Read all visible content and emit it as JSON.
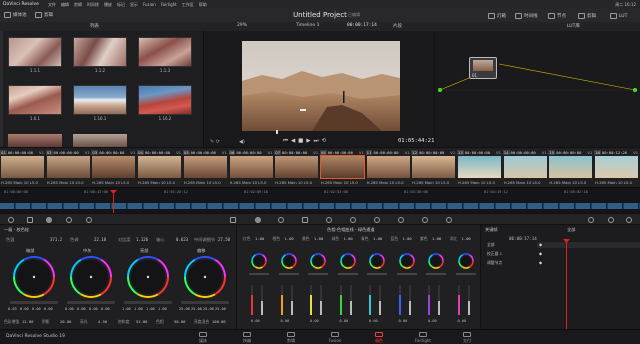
{
  "menubar": {
    "app_name": "DaVinci Resolve",
    "items": [
      "文件",
      "编辑",
      "剪辑",
      "时间线",
      "播放",
      "标记",
      "显示",
      "Fusion",
      "Fairlight",
      "工作区",
      "帮助"
    ],
    "clock": "周二 16:12"
  },
  "toolbar": {
    "media_pool": "媒体池",
    "clips": "剪辑",
    "project_title": "Untitled Project",
    "project_tag": "已编辑",
    "lightbox": "灯箱",
    "gallery": "画廊",
    "timeline_label": "时间线",
    "clips_right": "剪辑",
    "nodes": "节点",
    "lut": "LUT"
  },
  "subbar": {
    "bin": "LUT库",
    "sort": "列表",
    "zoom": "29%",
    "timeline_name": "Timeline 1",
    "timecode": "00:00:17:14",
    "mode": "片段"
  },
  "media": {
    "thumbs": [
      {
        "label": "1.1.1"
      },
      {
        "label": "1.1.2"
      },
      {
        "label": "1.1.3"
      },
      {
        "label": "1.6.1"
      },
      {
        "label": "1.16.1"
      },
      {
        "label": "1.16.2"
      }
    ]
  },
  "viewer": {
    "timecode": "01:05:44:21"
  },
  "node": {
    "label": "01"
  },
  "clips": [
    {
      "num": "01",
      "tc": "00:00:00:00",
      "v": "V1",
      "name": "H.265 Main 10 L5.0"
    },
    {
      "num": "02",
      "tc": "00:00:00:00",
      "v": "V1",
      "name": "H.265 Main 10 L5.0"
    },
    {
      "num": "03",
      "tc": "00:00:00:00",
      "v": "V1",
      "name": "H.265 Main 10 L5.0"
    },
    {
      "num": "04",
      "tc": "00:00:00:00",
      "v": "V1",
      "name": "H.265 Main 10 L5.0"
    },
    {
      "num": "05",
      "tc": "00:00:00:00",
      "v": "V1",
      "name": "H.265 Main 10 L5.0"
    },
    {
      "num": "06",
      "tc": "00:00:00:00",
      "v": "V1",
      "name": "H.265 Main 10 L5.0"
    },
    {
      "num": "07",
      "tc": "00:00:00:00",
      "v": "V1",
      "name": "H.265 Main 10 L5.0"
    },
    {
      "num": "08",
      "tc": "00:00:00:00",
      "v": "V1",
      "name": "H.265 Main 10 L5.0"
    },
    {
      "num": "11",
      "tc": "00:00:00:00",
      "v": "V1",
      "name": "H.265 Main 10 L5.0"
    },
    {
      "num": "12",
      "tc": "00:00:00:00",
      "v": "V1",
      "name": "H.265 Main 10 L5.0"
    },
    {
      "num": "13",
      "tc": "00:00:00:00",
      "v": "V1",
      "name": "H.265 Main 10 L5.0"
    },
    {
      "num": "14",
      "tc": "00:00:00:00",
      "v": "V1",
      "name": "H.265 Main 10 L5.0"
    },
    {
      "num": "15",
      "tc": "00:00:00:00",
      "v": "V1",
      "name": "H.265 Main 10 L5.0"
    },
    {
      "num": "16",
      "tc": "00:00:12:26",
      "v": "V1",
      "name": "H.265 Main 10 L5.0"
    }
  ],
  "minitl": {
    "ticks": [
      "01:00:00:00",
      "01:00:43:06",
      "01:01:26:12",
      "01:02:09:18",
      "01:02:53:00",
      "01:03:36:06",
      "01:04:19:12",
      "01:05:02:18"
    ]
  },
  "wheels": {
    "panel_title": "一级 - 校色轮",
    "temp_label": "色温",
    "temp_val": "371.2",
    "tint_label": "色调",
    "tint_val": "22.18",
    "contrast_label": "对比度",
    "contrast_val": "1.126",
    "pivot_label": "轴心",
    "pivot_val": "0.623",
    "md_label": "中间调细节",
    "md_val": "27.50",
    "names": [
      "暗部",
      "中灰",
      "亮部",
      "偏移"
    ],
    "vals": [
      [
        "0.03",
        "0.00",
        "0.00",
        "0.00"
      ],
      [
        "0.00",
        "0.00",
        "0.00",
        "0.00"
      ],
      [
        "1.00",
        "1.00",
        "1.00",
        "1.00"
      ],
      [
        "25.00",
        "25.00",
        "25.00",
        "25.00"
      ]
    ],
    "bottom": [
      {
        "label": "色彩增强",
        "val": "12.00"
      },
      {
        "label": "阴影",
        "val": "20.00"
      },
      {
        "label": "高光",
        "val": "4.50"
      },
      {
        "label": "饱和度",
        "val": "51.80"
      },
      {
        "label": "色相",
        "val": "50.00"
      },
      {
        "label": "亮度混合",
        "val": "100.00"
      }
    ]
  },
  "hsl": {
    "title": "色相-色相曲线 - 绿色通道",
    "labels": [
      "红色",
      "橙色",
      "黄色",
      "绿色",
      "青色",
      "蓝色",
      "紫色",
      "洋红"
    ],
    "row_vals": [
      "1.00",
      "1.00",
      "1.00",
      "1.00",
      "1.00",
      "1.00",
      "1.00",
      "1.00"
    ],
    "bottom": [
      "0.00",
      "0.00",
      "0.00",
      "0.00",
      "0.00",
      "0.00",
      "0.00",
      "0.00"
    ]
  },
  "keys": {
    "title": "关键帧",
    "mode": "全部",
    "tc": "00:00:17:14",
    "rows": [
      "全部",
      "校正器 1",
      "调整节点"
    ]
  },
  "pages": [
    {
      "label": "媒体"
    },
    {
      "label": "快编"
    },
    {
      "label": "剪辑"
    },
    {
      "label": "Fusion"
    },
    {
      "label": "调色"
    },
    {
      "label": "Fairlight"
    },
    {
      "label": "交付"
    }
  ],
  "brand": "DaVinci Resolve Studio 19",
  "colors": {
    "accent": "#ff3b3b",
    "playhead": "#e02020",
    "panel": "#1f1f21"
  }
}
